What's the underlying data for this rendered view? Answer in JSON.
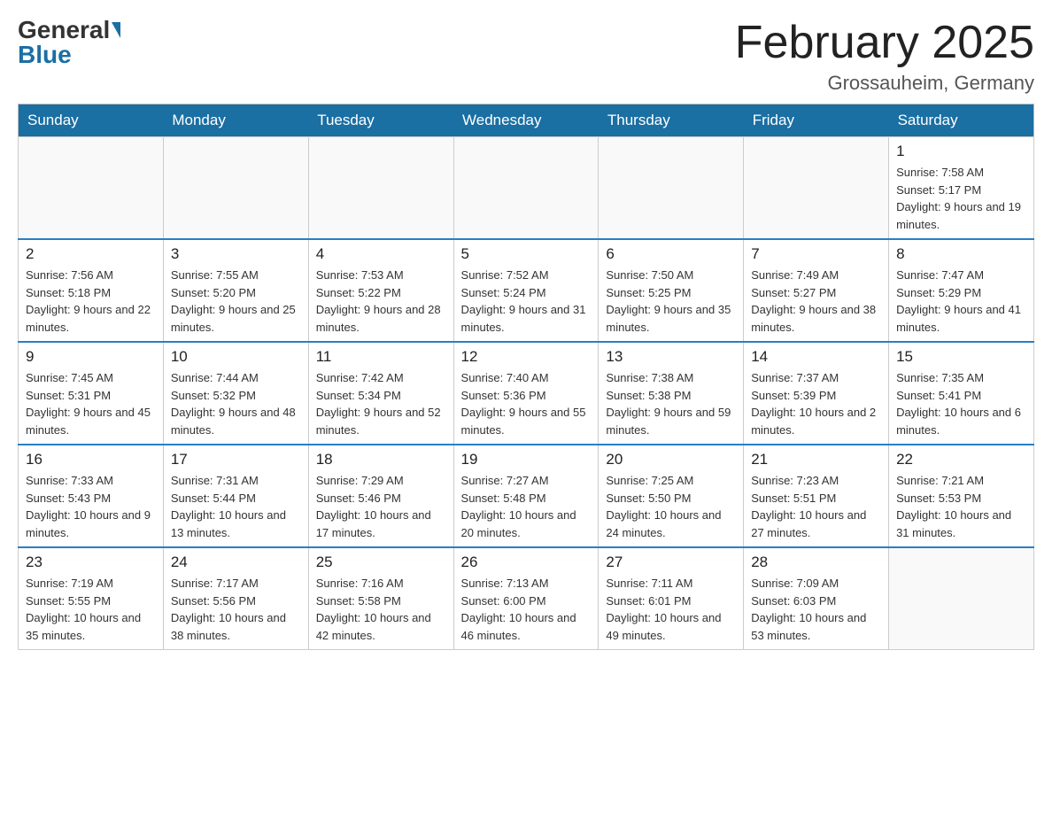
{
  "header": {
    "logo_general": "General",
    "logo_blue": "Blue",
    "month_title": "February 2025",
    "location": "Grossauheim, Germany"
  },
  "days_of_week": [
    "Sunday",
    "Monday",
    "Tuesday",
    "Wednesday",
    "Thursday",
    "Friday",
    "Saturday"
  ],
  "weeks": [
    [
      {
        "day": "",
        "info": ""
      },
      {
        "day": "",
        "info": ""
      },
      {
        "day": "",
        "info": ""
      },
      {
        "day": "",
        "info": ""
      },
      {
        "day": "",
        "info": ""
      },
      {
        "day": "",
        "info": ""
      },
      {
        "day": "1",
        "info": "Sunrise: 7:58 AM\nSunset: 5:17 PM\nDaylight: 9 hours and 19 minutes."
      }
    ],
    [
      {
        "day": "2",
        "info": "Sunrise: 7:56 AM\nSunset: 5:18 PM\nDaylight: 9 hours and 22 minutes."
      },
      {
        "day": "3",
        "info": "Sunrise: 7:55 AM\nSunset: 5:20 PM\nDaylight: 9 hours and 25 minutes."
      },
      {
        "day": "4",
        "info": "Sunrise: 7:53 AM\nSunset: 5:22 PM\nDaylight: 9 hours and 28 minutes."
      },
      {
        "day": "5",
        "info": "Sunrise: 7:52 AM\nSunset: 5:24 PM\nDaylight: 9 hours and 31 minutes."
      },
      {
        "day": "6",
        "info": "Sunrise: 7:50 AM\nSunset: 5:25 PM\nDaylight: 9 hours and 35 minutes."
      },
      {
        "day": "7",
        "info": "Sunrise: 7:49 AM\nSunset: 5:27 PM\nDaylight: 9 hours and 38 minutes."
      },
      {
        "day": "8",
        "info": "Sunrise: 7:47 AM\nSunset: 5:29 PM\nDaylight: 9 hours and 41 minutes."
      }
    ],
    [
      {
        "day": "9",
        "info": "Sunrise: 7:45 AM\nSunset: 5:31 PM\nDaylight: 9 hours and 45 minutes."
      },
      {
        "day": "10",
        "info": "Sunrise: 7:44 AM\nSunset: 5:32 PM\nDaylight: 9 hours and 48 minutes."
      },
      {
        "day": "11",
        "info": "Sunrise: 7:42 AM\nSunset: 5:34 PM\nDaylight: 9 hours and 52 minutes."
      },
      {
        "day": "12",
        "info": "Sunrise: 7:40 AM\nSunset: 5:36 PM\nDaylight: 9 hours and 55 minutes."
      },
      {
        "day": "13",
        "info": "Sunrise: 7:38 AM\nSunset: 5:38 PM\nDaylight: 9 hours and 59 minutes."
      },
      {
        "day": "14",
        "info": "Sunrise: 7:37 AM\nSunset: 5:39 PM\nDaylight: 10 hours and 2 minutes."
      },
      {
        "day": "15",
        "info": "Sunrise: 7:35 AM\nSunset: 5:41 PM\nDaylight: 10 hours and 6 minutes."
      }
    ],
    [
      {
        "day": "16",
        "info": "Sunrise: 7:33 AM\nSunset: 5:43 PM\nDaylight: 10 hours and 9 minutes."
      },
      {
        "day": "17",
        "info": "Sunrise: 7:31 AM\nSunset: 5:44 PM\nDaylight: 10 hours and 13 minutes."
      },
      {
        "day": "18",
        "info": "Sunrise: 7:29 AM\nSunset: 5:46 PM\nDaylight: 10 hours and 17 minutes."
      },
      {
        "day": "19",
        "info": "Sunrise: 7:27 AM\nSunset: 5:48 PM\nDaylight: 10 hours and 20 minutes."
      },
      {
        "day": "20",
        "info": "Sunrise: 7:25 AM\nSunset: 5:50 PM\nDaylight: 10 hours and 24 minutes."
      },
      {
        "day": "21",
        "info": "Sunrise: 7:23 AM\nSunset: 5:51 PM\nDaylight: 10 hours and 27 minutes."
      },
      {
        "day": "22",
        "info": "Sunrise: 7:21 AM\nSunset: 5:53 PM\nDaylight: 10 hours and 31 minutes."
      }
    ],
    [
      {
        "day": "23",
        "info": "Sunrise: 7:19 AM\nSunset: 5:55 PM\nDaylight: 10 hours and 35 minutes."
      },
      {
        "day": "24",
        "info": "Sunrise: 7:17 AM\nSunset: 5:56 PM\nDaylight: 10 hours and 38 minutes."
      },
      {
        "day": "25",
        "info": "Sunrise: 7:16 AM\nSunset: 5:58 PM\nDaylight: 10 hours and 42 minutes."
      },
      {
        "day": "26",
        "info": "Sunrise: 7:13 AM\nSunset: 6:00 PM\nDaylight: 10 hours and 46 minutes."
      },
      {
        "day": "27",
        "info": "Sunrise: 7:11 AM\nSunset: 6:01 PM\nDaylight: 10 hours and 49 minutes."
      },
      {
        "day": "28",
        "info": "Sunrise: 7:09 AM\nSunset: 6:03 PM\nDaylight: 10 hours and 53 minutes."
      },
      {
        "day": "",
        "info": ""
      }
    ]
  ]
}
